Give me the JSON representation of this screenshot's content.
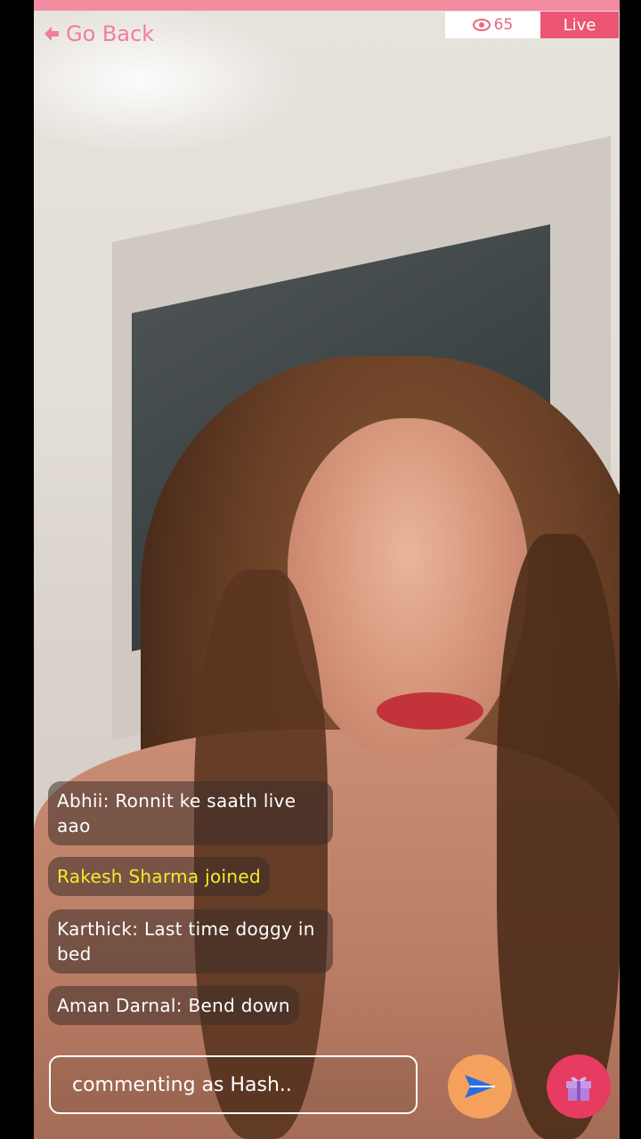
{
  "header": {
    "back_label": "Go Back",
    "viewer_count": "65",
    "live_label": "Live"
  },
  "chat": {
    "messages": [
      {
        "text": "Abhii: Ronnit ke saath live aao",
        "type": "comment"
      },
      {
        "text": "Rakesh Sharma joined",
        "type": "join"
      },
      {
        "text": "Karthick: Last time doggy in bed",
        "type": "comment"
      },
      {
        "text": "Aman Darnal: Bend down",
        "type": "comment"
      }
    ]
  },
  "composer": {
    "placeholder": "commenting as Hash.."
  },
  "icons": {
    "back": "arrow-left-icon",
    "viewers": "eye-icon",
    "send": "send-icon",
    "gift": "gift-icon"
  },
  "colors": {
    "accent_pink": "#f07f98",
    "live_red": "#ec5673",
    "send_orange": "#f4a15e",
    "gift_red": "#e83b61",
    "join_yellow": "#f4ea2c"
  }
}
